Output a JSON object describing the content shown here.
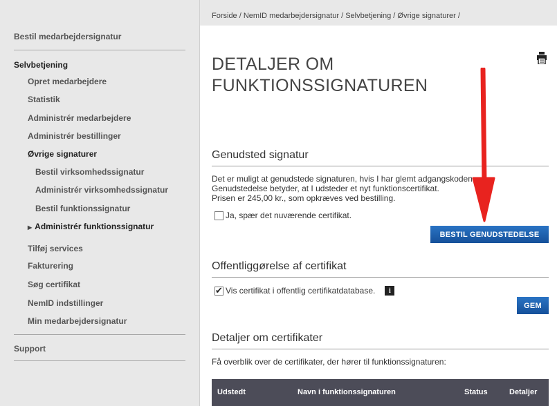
{
  "breadcrumb": "Forside / NemID medarbejdersignatur / Selvbetjening / Øvrige signaturer /",
  "sidebar": {
    "items": [
      {
        "label": "Bestil medarbejdersignatur"
      },
      {
        "label": "Selvbetjening"
      },
      {
        "label": "Opret medarbejdere"
      },
      {
        "label": "Statistik"
      },
      {
        "label": "Administrér medarbejdere"
      },
      {
        "label": "Administrér bestillinger"
      },
      {
        "label": "Øvrige signaturer"
      },
      {
        "label": "Bestil virksomhedssignatur"
      },
      {
        "label": "Administrér virksomhedssignatur"
      },
      {
        "label": "Bestil funktionssignatur"
      },
      {
        "label": "Administrér funktionssignatur"
      },
      {
        "label": "Tilføj services"
      },
      {
        "label": "Fakturering"
      },
      {
        "label": "Søg certifikat"
      },
      {
        "label": "NemID indstillinger"
      },
      {
        "label": "Min medarbejdersignatur"
      },
      {
        "label": "Support"
      }
    ]
  },
  "page": {
    "title_line1": "DETALJER OM",
    "title_line2": "FUNKTIONSSIGNATUREN"
  },
  "reissue": {
    "title": "Genudsted signatur",
    "line1": "Det er muligt at genudstede signaturen, hvis I har glemt adgangskoden.",
    "line2": "Genudstedelse betyder, at I udsteder et nyt funktionscertifikat.",
    "line3": "Prisen er 245,00 kr., som opkræves ved bestilling.",
    "checkbox_label": "Ja, spær det nuværende certifikat.",
    "checkbox_checked": false,
    "button_label": "BESTIL GENUDSTEDELSE"
  },
  "publish": {
    "title": "Offentliggørelse af certifikat",
    "checkbox_label": "Vis certifikat i offentlig certifikatdatabase.",
    "checkbox_checked": true,
    "info_glyph": "i",
    "button_label": "GEM"
  },
  "certs": {
    "title": "Detaljer om certifikater",
    "intro": "Få overblik over de certifikater, der hører til funktionssignaturen:",
    "columns": [
      "Udstedt",
      "Navn i funktionssignaturen",
      "Status",
      "Detaljer"
    ]
  },
  "colors": {
    "sidebar_bg": "#e8e8e8",
    "button_blue": "#1d5fae",
    "table_header": "#4c4c58",
    "annotation_arrow": "#e8231f"
  },
  "icons": {
    "print": "printer-icon",
    "info": "info-icon",
    "expand": "triangle-right-icon"
  }
}
